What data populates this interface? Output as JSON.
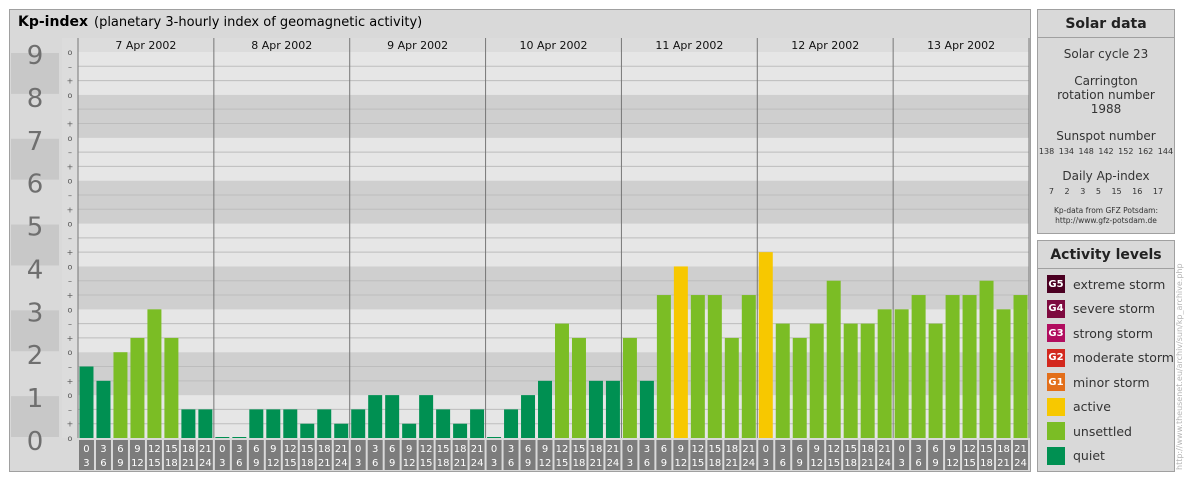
{
  "chart": {
    "title": "Kp-index",
    "subtitle": "(planetary 3-hourly index of geomagnetic activity)"
  },
  "chart_data": {
    "type": "bar",
    "title": "Kp-index",
    "subtitle": "(planetary 3-hourly index of geomagnetic activity)",
    "ylim": [
      0,
      9
    ],
    "y_ticks": [
      "0",
      "1",
      "2",
      "3",
      "4",
      "5",
      "6",
      "7",
      "8",
      "9"
    ],
    "y_subticks": [
      "–",
      "o",
      "+"
    ],
    "days": [
      "7 Apr 2002",
      "8 Apr 2002",
      "9 Apr 2002",
      "10 Apr 2002",
      "11 Apr 2002",
      "12 Apr 2002",
      "13 Apr 2002"
    ],
    "interval_start": [
      "0",
      "3",
      "6",
      "9",
      "12",
      "15",
      "18",
      "21"
    ],
    "interval_end": [
      "3",
      "6",
      "9",
      "12",
      "15",
      "18",
      "21",
      "24"
    ],
    "values": [
      1.667,
      1.333,
      2.0,
      2.333,
      3.0,
      2.333,
      0.667,
      0.667,
      0.0,
      0.0,
      0.667,
      0.667,
      0.667,
      0.333,
      0.667,
      0.333,
      0.667,
      1.0,
      1.0,
      0.333,
      1.0,
      0.667,
      0.333,
      0.667,
      0.0,
      0.667,
      1.0,
      1.333,
      2.667,
      2.333,
      1.333,
      1.333,
      2.333,
      1.333,
      3.333,
      4.0,
      3.333,
      3.333,
      2.333,
      3.333,
      4.333,
      2.667,
      2.333,
      2.667,
      3.667,
      2.667,
      2.667,
      3.0,
      3.0,
      3.333,
      2.667,
      3.333,
      3.333,
      3.667,
      3.0,
      3.333
    ],
    "colors": {
      "quiet": "#009052",
      "unsettled": "#7bbd25",
      "active": "#f7c800",
      "G1": "#e36f1a",
      "G2": "#d3281e",
      "G3": "#b10d5f",
      "G4": "#7e0a3f",
      "G5": "#4b0022"
    }
  },
  "solar": {
    "title": "Solar data",
    "cycle": "Solar cycle 23",
    "carrington": "Carrington rotation number 1988",
    "sunspot_label": "Sunspot number",
    "sunspot_values": "138 134 148 142 152 162 144",
    "ap_label": "Daily Ap-index",
    "ap_values": "7 2 3 5 15 16 17",
    "source_line1": "Kp-data from GFZ Potsdam:",
    "source_line2": "http://www.gfz-potsdam.de"
  },
  "activity": {
    "title": "Activity levels",
    "items": [
      {
        "code": "G5",
        "label": "extreme storm",
        "color": "#4b0022"
      },
      {
        "code": "G4",
        "label": "severe storm",
        "color": "#7e0a3f"
      },
      {
        "code": "G3",
        "label": "strong storm",
        "color": "#b10d5f"
      },
      {
        "code": "G2",
        "label": "moderate storm",
        "color": "#d3281e"
      },
      {
        "code": "G1",
        "label": "minor storm",
        "color": "#e36f1a"
      },
      {
        "code": "",
        "label": "active",
        "color": "#f7c800"
      },
      {
        "code": "",
        "label": "unsettled",
        "color": "#7bbd25"
      },
      {
        "code": "",
        "label": "quiet",
        "color": "#009052"
      }
    ]
  },
  "watermark": "http://www.theusenet.eu/archiv/sun/kp_archive.php"
}
